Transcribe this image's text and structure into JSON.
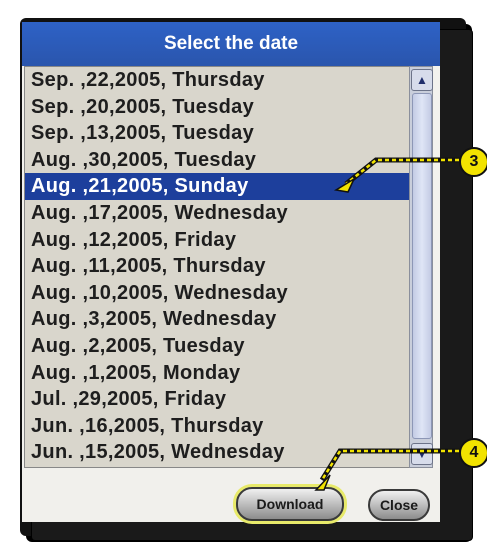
{
  "dialog": {
    "title": "Select the date",
    "dates": [
      "Sep. ,22,2005, Thursday",
      "Sep. ,20,2005, Tuesday",
      "Sep. ,13,2005, Tuesday",
      "Aug. ,30,2005, Tuesday",
      "Aug. ,21,2005, Sunday",
      "Aug. ,17,2005, Wednesday",
      "Aug. ,12,2005, Friday",
      "Aug. ,11,2005, Thursday",
      "Aug. ,10,2005, Wednesday",
      "Aug. ,3,2005, Wednesday",
      "Aug. ,2,2005, Tuesday",
      "Aug. ,1,2005, Monday",
      "Jul. ,29,2005, Friday",
      "Jun. ,16,2005, Thursday",
      "Jun. ,15,2005, Wednesday"
    ],
    "selected_index": 4,
    "download_label": "Download",
    "close_label": "Close"
  },
  "callouts": {
    "step3": "3",
    "step4": "4"
  },
  "colors": {
    "titlebar": "#2e62c6",
    "selection": "#1d3f9c",
    "callout": "#f2e300"
  },
  "icons": {
    "scroll_up": "chevron-up-icon",
    "scroll_down": "chevron-down-icon"
  }
}
